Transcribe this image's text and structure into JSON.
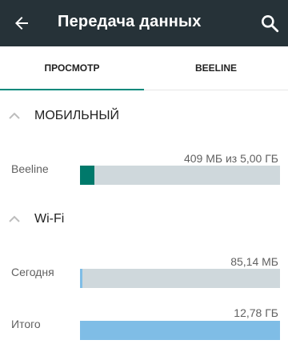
{
  "appbar": {
    "title": "Передача данных",
    "back_icon": "arrow-back-icon",
    "search_icon": "search-icon"
  },
  "tabs": [
    {
      "label": "ПРОСМОТР",
      "selected": true
    },
    {
      "label": "BEELINE",
      "selected": false
    }
  ],
  "mobile": {
    "header": "МОБИЛЬНЫЙ",
    "rows": [
      {
        "label": "Beeline",
        "value": "409 МБ из 5,00 ГБ",
        "fill_fraction": 0.072,
        "color": "#00796b"
      }
    ]
  },
  "wifi": {
    "header": "Wi-Fi",
    "rows": [
      {
        "label": "Сегодня",
        "value": "85,14 МБ",
        "fill_fraction": 0.01,
        "color": "#7fbde6"
      },
      {
        "label": "Итого",
        "value": "12,78 ГБ",
        "fill_fraction": 1.0,
        "color": "#7fbde6"
      }
    ]
  },
  "colors": {
    "appbar": "#263238",
    "accent": "#00897b",
    "track": "#cfd8dc"
  }
}
